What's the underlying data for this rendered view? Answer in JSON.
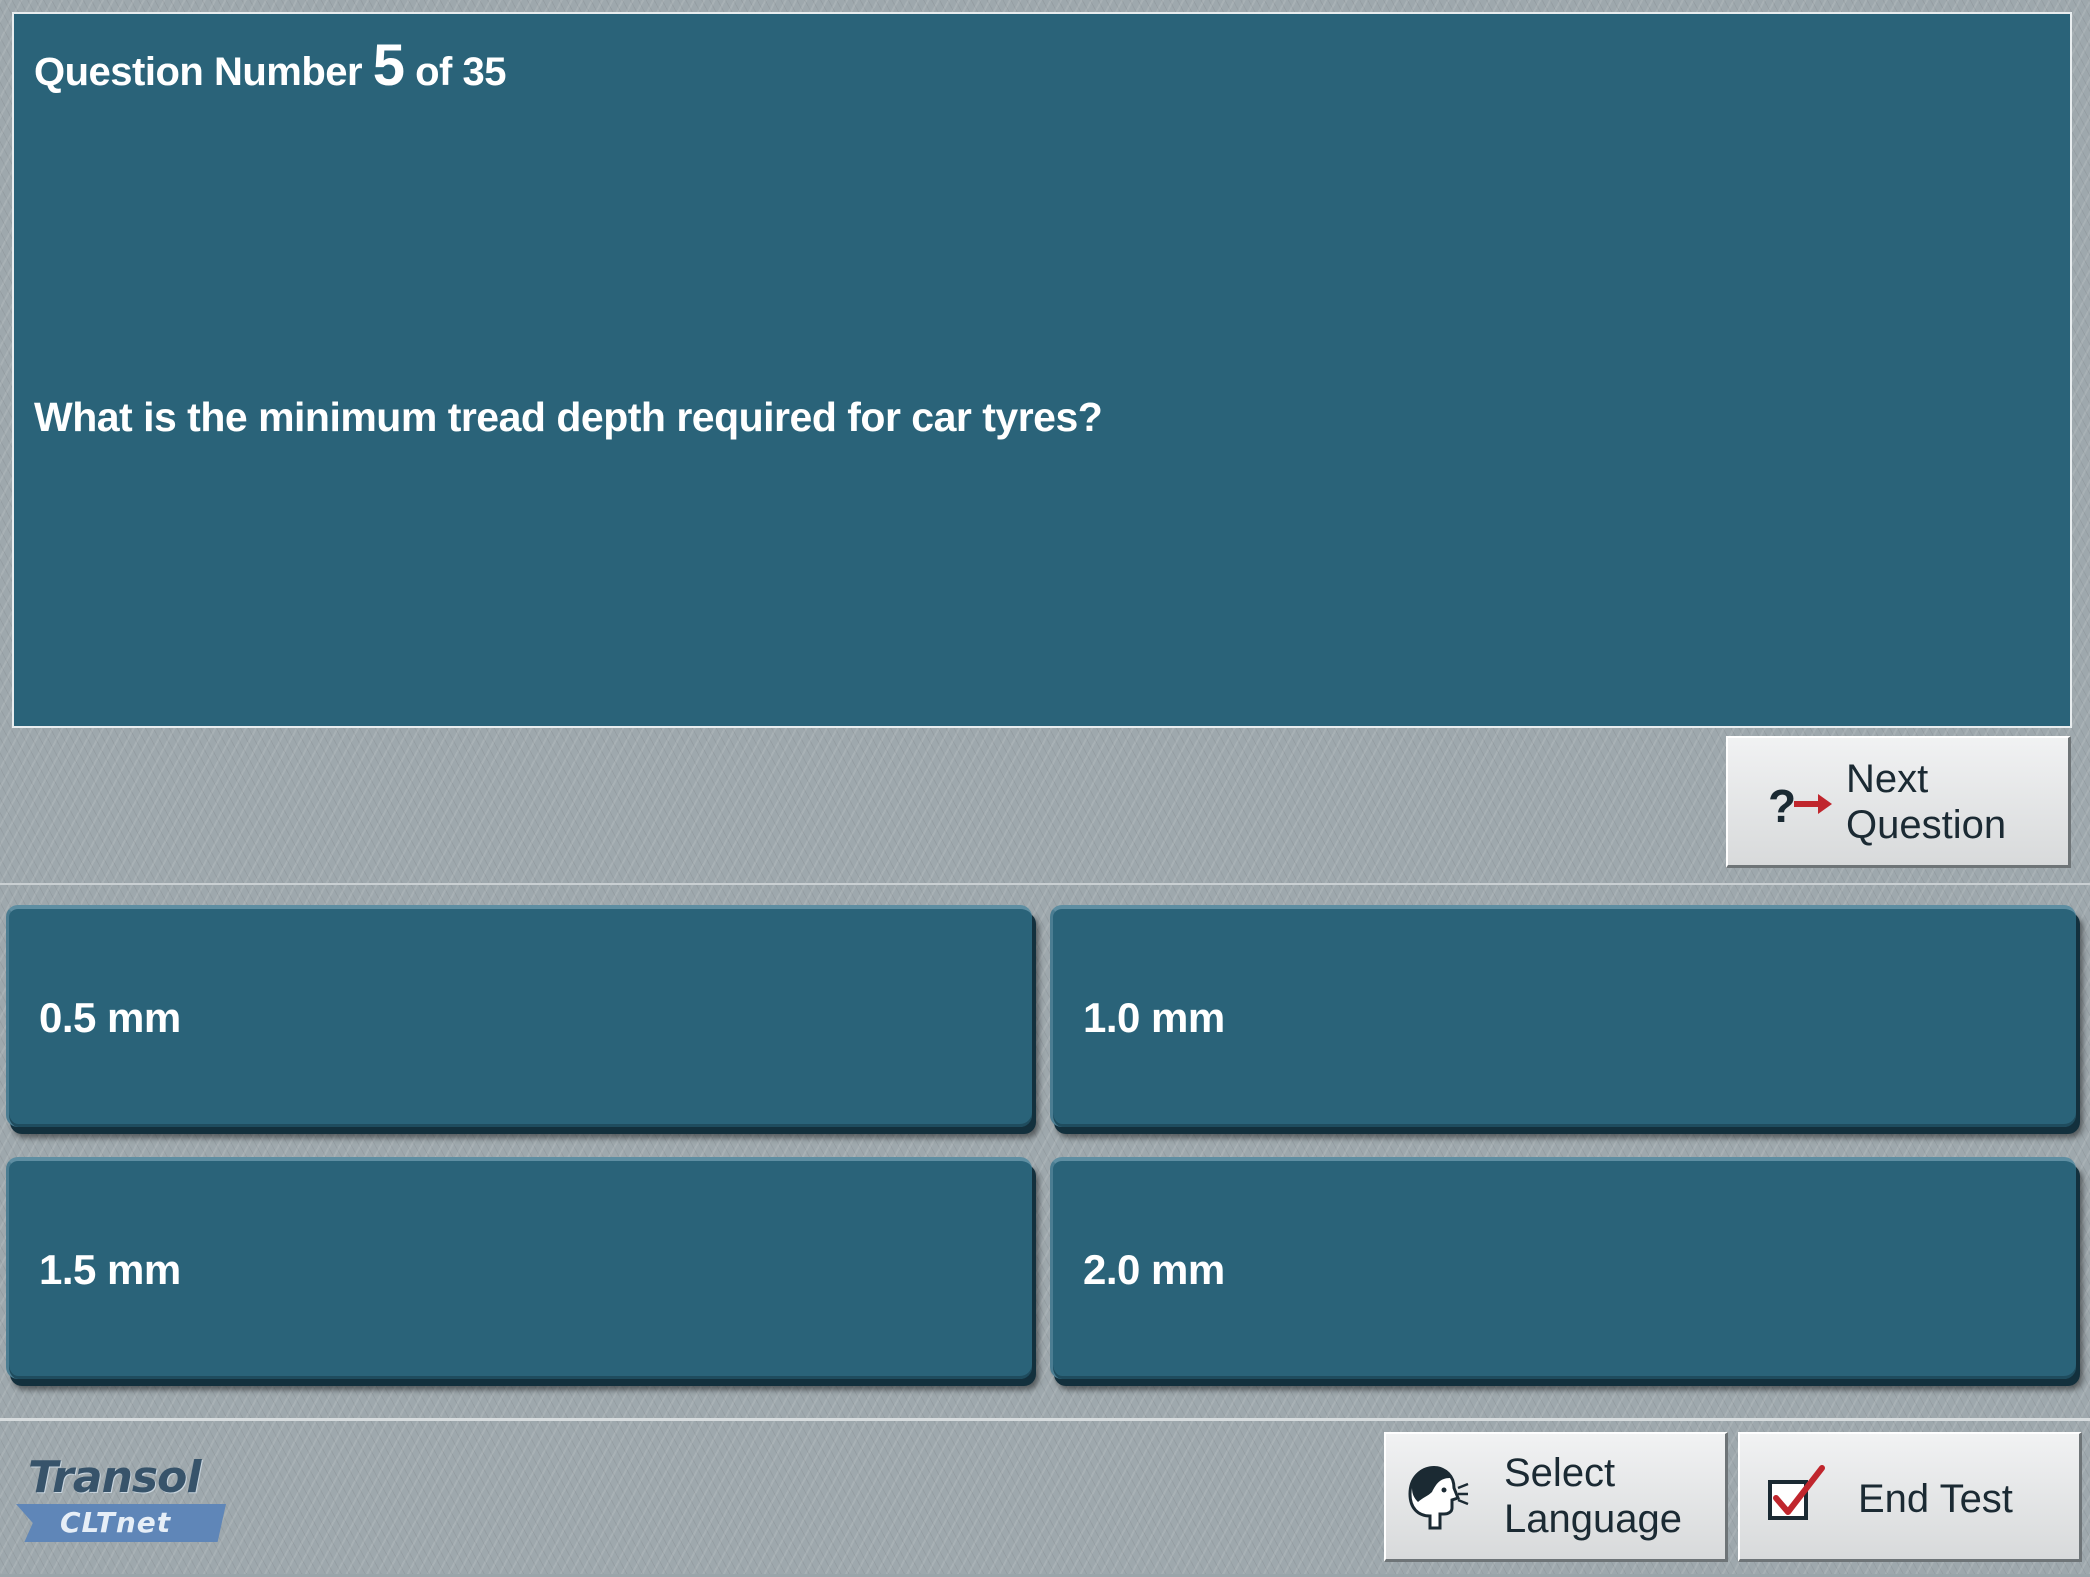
{
  "question": {
    "number_prefix": "Question Number",
    "number": "5",
    "number_suffix": "of 35",
    "text": "What is the minimum tread depth required for car tyres?"
  },
  "answers": [
    {
      "label": "0.5 mm"
    },
    {
      "label": "1.0 mm"
    },
    {
      "label": "1.5 mm"
    },
    {
      "label": "2.0 mm"
    }
  ],
  "buttons": {
    "next_question": {
      "line1": "Next",
      "line2": "Question",
      "icon": "question-arrow-icon"
    },
    "select_language": {
      "line1": "Select",
      "line2": "Language",
      "icon": "speaking-head-icon"
    },
    "end_test": {
      "label": "End Test",
      "icon": "checkbox-tick-icon"
    }
  },
  "logo": {
    "name": "Transol",
    "product": "CLTnet"
  },
  "colors": {
    "panel": "#2a6379",
    "background": "#9ea8ad",
    "accent_red": "#c0262d"
  }
}
